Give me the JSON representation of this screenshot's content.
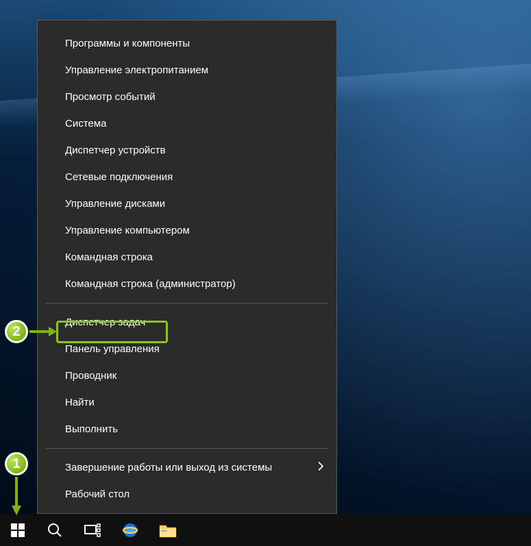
{
  "menu": {
    "groups": [
      [
        "Программы и компоненты",
        "Управление электропитанием",
        "Просмотр событий",
        "Система",
        "Диспетчер устройств",
        "Сетевые подключения",
        "Управление дисками",
        "Управление компьютером",
        "Командная строка",
        "Командная строка (администратор)"
      ],
      [
        "Диспетчер задач",
        "Панель управления",
        "Проводник",
        "Найти",
        "Выполнить"
      ],
      [
        "Завершение работы или выход из системы",
        "Рабочий стол"
      ]
    ],
    "submenu_item": "Завершение работы или выход из системы",
    "highlighted_item": "Панель управления"
  },
  "annotations": {
    "one": "1",
    "two": "2"
  },
  "taskbar": {
    "start": "start",
    "search": "search",
    "taskview": "task-view",
    "ie": "internet-explorer",
    "explorer": "file-explorer"
  }
}
